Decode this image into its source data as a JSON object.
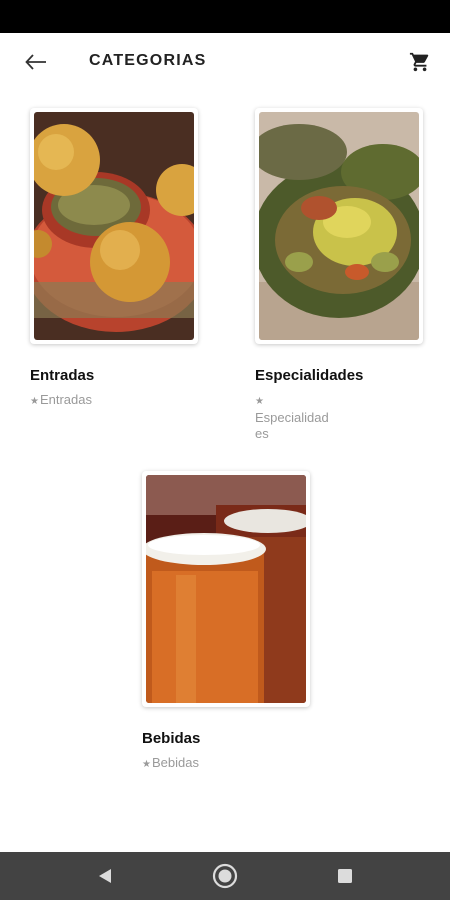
{
  "app_bar": {
    "title": "CATEGORIAS"
  },
  "categories": [
    {
      "title": "Entradas",
      "subtitle": "Entradas"
    },
    {
      "title": "Especialidades",
      "subtitle": "Especialidades"
    },
    {
      "title": "Bebidas",
      "subtitle": "Bebidas"
    }
  ],
  "icons": {
    "back": "arrow-left-icon",
    "cart": "shopping-cart-icon",
    "nav_back": "triangle-back-icon",
    "nav_home": "circle-home-icon",
    "nav_recents": "square-recents-icon"
  }
}
